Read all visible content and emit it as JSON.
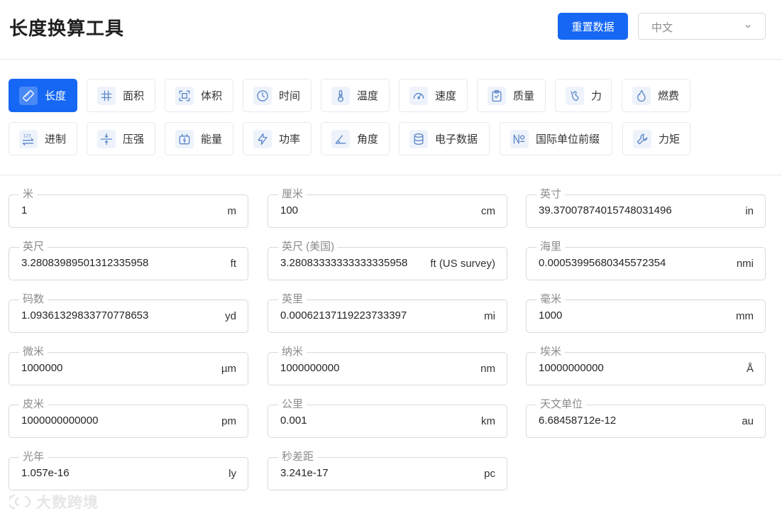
{
  "header": {
    "title": "长度换算工具",
    "reset_label": "重置数据",
    "language": "中文"
  },
  "categories": [
    {
      "label": "长度",
      "icon": "ruler-icon",
      "active": true
    },
    {
      "label": "面积",
      "icon": "hash-icon"
    },
    {
      "label": "体积",
      "icon": "frame-icon"
    },
    {
      "label": "时间",
      "icon": "clock-icon"
    },
    {
      "label": "温度",
      "icon": "thermometer-icon"
    },
    {
      "label": "速度",
      "icon": "speedometer-icon"
    },
    {
      "label": "质量",
      "icon": "clipboard-icon"
    },
    {
      "label": "力",
      "icon": "force-icon"
    },
    {
      "label": "燃费",
      "icon": "flame-icon"
    },
    {
      "label": "进制",
      "icon": "number-base-icon"
    },
    {
      "label": "压强",
      "icon": "pressure-icon"
    },
    {
      "label": "能量",
      "icon": "battery-icon"
    },
    {
      "label": "功率",
      "icon": "lightning-icon"
    },
    {
      "label": "角度",
      "icon": "angle-icon"
    },
    {
      "label": "电子数据",
      "icon": "database-icon"
    },
    {
      "label": "国际单位前缀",
      "icon": "numero-icon"
    },
    {
      "label": "力矩",
      "icon": "wrench-icon"
    }
  ],
  "fields": [
    {
      "label": "米",
      "value": "1",
      "unit": "m"
    },
    {
      "label": "厘米",
      "value": "100",
      "unit": "cm"
    },
    {
      "label": "英寸",
      "value": "39.37007874015748031496",
      "unit": "in"
    },
    {
      "label": "英尺",
      "value": "3.28083989501312335958",
      "unit": "ft"
    },
    {
      "label": "英尺 (美国)",
      "value": "3.28083333333333335958",
      "unit": "ft (US survey)"
    },
    {
      "label": "海里",
      "value": "0.00053995680345572354",
      "unit": "nmi"
    },
    {
      "label": "码数",
      "value": "1.09361329833770778653",
      "unit": "yd"
    },
    {
      "label": "英里",
      "value": "0.00062137119223733397",
      "unit": "mi"
    },
    {
      "label": "毫米",
      "value": "1000",
      "unit": "mm"
    },
    {
      "label": "微米",
      "value": "1000000",
      "unit": "µm"
    },
    {
      "label": "纳米",
      "value": "1000000000",
      "unit": "nm"
    },
    {
      "label": "埃米",
      "value": "10000000000",
      "unit": "Å"
    },
    {
      "label": "皮米",
      "value": "1000000000000",
      "unit": "pm"
    },
    {
      "label": "公里",
      "value": "0.001",
      "unit": "km"
    },
    {
      "label": "天文单位",
      "value": "6.68458712e-12",
      "unit": "au"
    },
    {
      "label": "光年",
      "value": "1.057e-16",
      "unit": "ly"
    },
    {
      "label": "秒差距",
      "value": "3.241e-17",
      "unit": "pc"
    }
  ],
  "watermark": "大数跨境",
  "colors": {
    "accent": "#1668f4",
    "border": "#d9d9d9",
    "icon": "#5b86c8"
  }
}
